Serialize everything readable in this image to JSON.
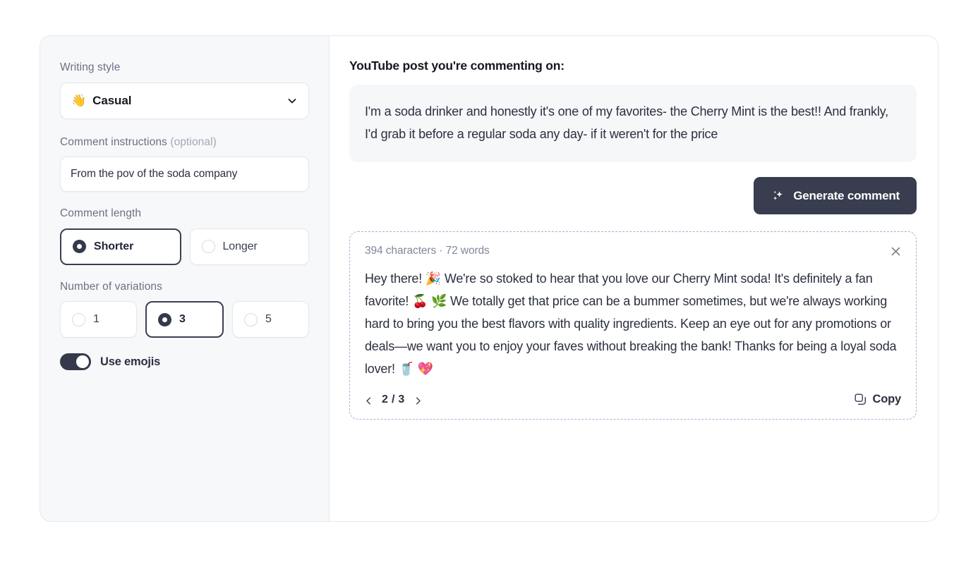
{
  "settings": {
    "writing_style": {
      "label": "Writing style",
      "emoji": "👋",
      "value": "Casual",
      "chevron_icon": "chevron-down-icon"
    },
    "instructions": {
      "label": "Comment instructions",
      "label_optional": "(optional)",
      "value": "From the pov of the soda company",
      "placeholder": "From the pov of the soda company"
    },
    "comment_length": {
      "label": "Comment length",
      "options": [
        {
          "label": "Shorter",
          "selected": true
        },
        {
          "label": "Longer",
          "selected": false
        }
      ]
    },
    "variations": {
      "label": "Number of variations",
      "options": [
        {
          "label": "1",
          "selected": false
        },
        {
          "label": "3",
          "selected": true
        },
        {
          "label": "5",
          "selected": false
        }
      ]
    },
    "use_emojis": {
      "label": "Use emojis",
      "on": true
    }
  },
  "content": {
    "title": "YouTube post you're commenting on:",
    "source_post": "I'm a soda drinker and honestly it's one of my favorites- the Cherry Mint is the best!! And frankly, I'd grab it before a regular soda any day- if it weren't for the price",
    "generate_button": "Generate comment",
    "generate_icon": "sparkles-icon",
    "result": {
      "meta": "394 characters · 72 words",
      "close_icon": "close-icon",
      "text": "Hey there! 🎉 We're so stoked to hear that you love our Cherry Mint soda! It's definitely a fan favorite! 🍒 🌿 We totally get that price can be a bummer sometimes, but we're always working hard to bring you the best flavors with quality ingredients. Keep an eye out for any promotions or deals—we want you to enjoy your faves without breaking the bank! Thanks for being a loyal soda lover! 🥤 💖",
      "page_indicator": "2 / 3",
      "prev_icon": "chevron-left-icon",
      "next_icon": "chevron-right-icon",
      "copy_label": "Copy",
      "copy_icon": "copy-icon"
    }
  },
  "colors": {
    "accent_dark": "#383e4f",
    "panel_bg": "#f7f8fa",
    "post_bg": "#f6f7f9",
    "dashed_border": "#bfa6d4"
  }
}
